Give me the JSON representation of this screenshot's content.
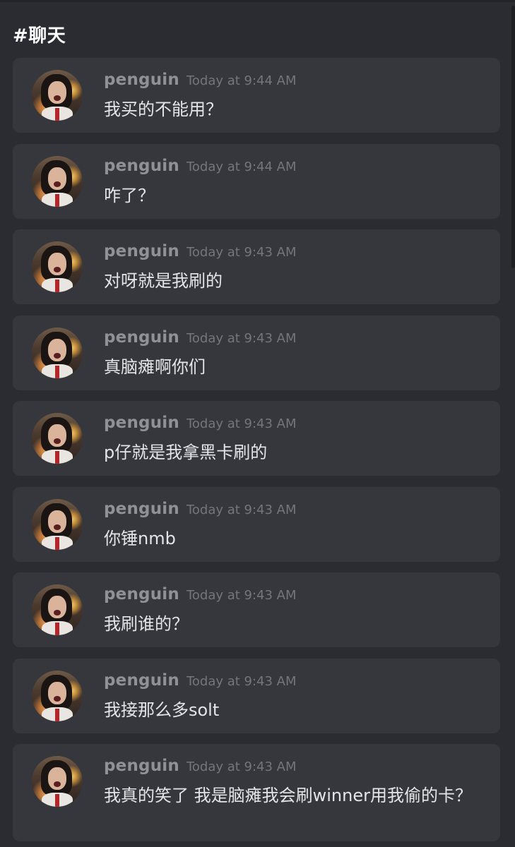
{
  "channel": {
    "title": "#聊天"
  },
  "messages": [
    {
      "username": "penguin",
      "timestamp": "Today at 9:44 AM",
      "text": "我买的不能用？"
    },
    {
      "username": "penguin",
      "timestamp": "Today at 9:44 AM",
      "text": "咋了？"
    },
    {
      "username": "penguin",
      "timestamp": "Today at 9:43 AM",
      "text": "对呀就是我刷的"
    },
    {
      "username": "penguin",
      "timestamp": "Today at 9:43 AM",
      "text": "真脑瘫啊你们"
    },
    {
      "username": "penguin",
      "timestamp": "Today at 9:43 AM",
      "text": "p仔就是我拿黑卡刷的"
    },
    {
      "username": "penguin",
      "timestamp": "Today at 9:43 AM",
      "text": "你锤nmb"
    },
    {
      "username": "penguin",
      "timestamp": "Today at 9:43 AM",
      "text": "我刷谁的？"
    },
    {
      "username": "penguin",
      "timestamp": "Today at 9:43 AM",
      "text": "我接那么多solt"
    },
    {
      "username": "penguin",
      "timestamp": "Today at 9:43 AM",
      "text": "我真的笑了 我是脑瘫我会刷winner用我偷的卡？"
    }
  ]
}
